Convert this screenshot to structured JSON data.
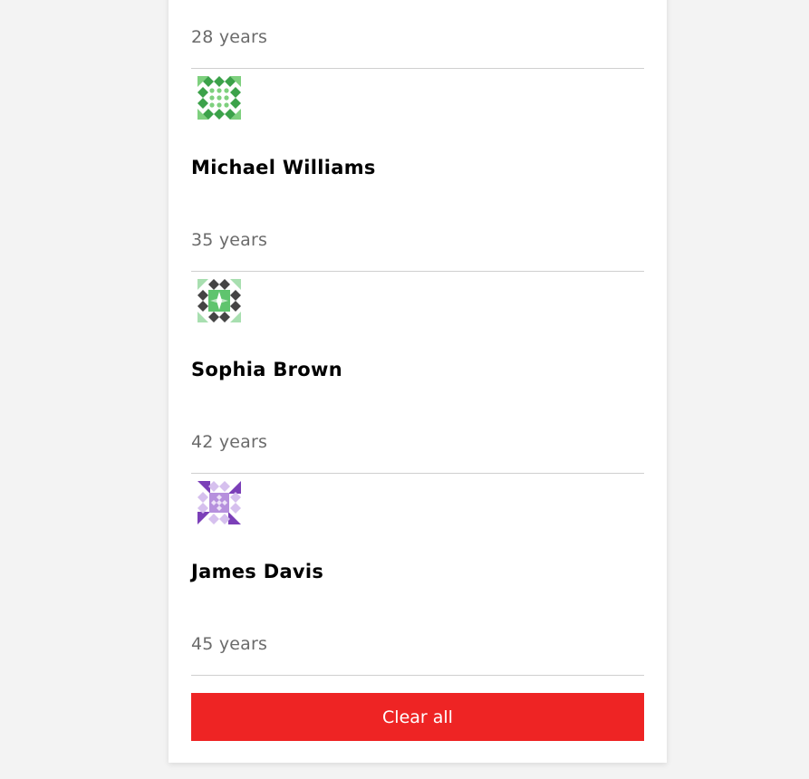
{
  "people": [
    {
      "age_label": "28 years"
    },
    {
      "name": "Michael Williams",
      "age_label": "35 years",
      "avatar_icon": "identicon-green"
    },
    {
      "name": "Sophia Brown",
      "age_label": "42 years",
      "avatar_icon": "identicon-dark-green"
    },
    {
      "name": "James Davis",
      "age_label": "45 years",
      "avatar_icon": "identicon-purple"
    }
  ],
  "actions": {
    "clear_label": "Clear all"
  },
  "colors": {
    "clear_button": "#ee2424",
    "age_text": "#6b6b6b",
    "divider": "#cfcfcf",
    "page_bg": "#f3f3f3"
  }
}
